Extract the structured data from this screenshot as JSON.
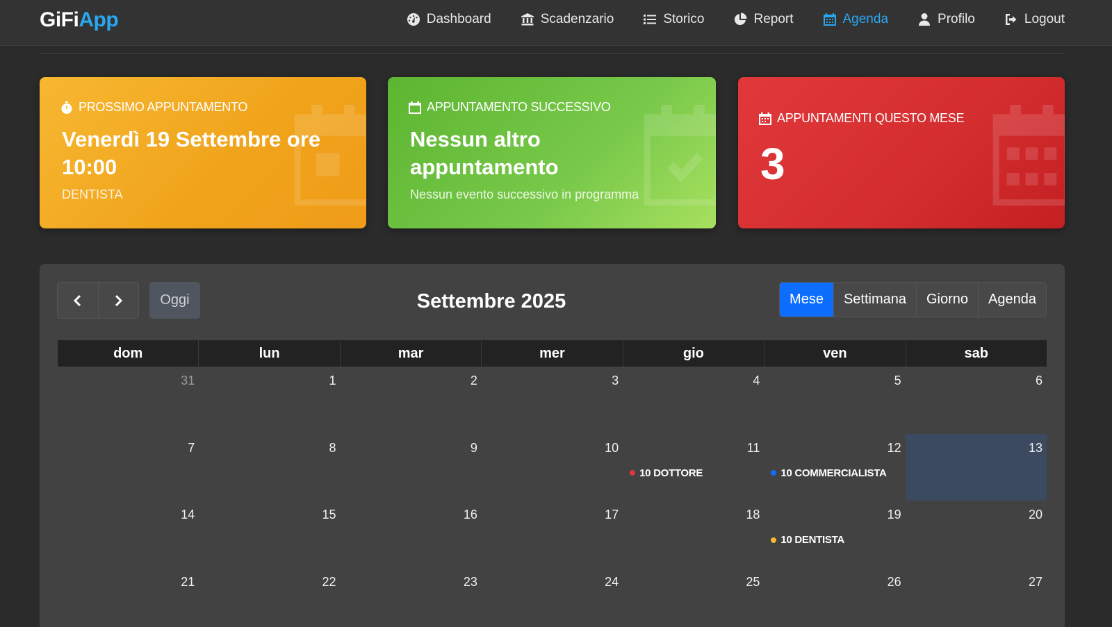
{
  "brand": {
    "part1": "GiFi",
    "part2": "App"
  },
  "nav": [
    {
      "label": "Dashboard",
      "icon": "dashboard-icon"
    },
    {
      "label": "Scadenzario",
      "icon": "bank-icon"
    },
    {
      "label": "Storico",
      "icon": "list-icon"
    },
    {
      "label": "Report",
      "icon": "pie-chart-icon"
    },
    {
      "label": "Agenda",
      "icon": "calendar-icon",
      "active": true
    },
    {
      "label": "Profilo",
      "icon": "user-icon"
    },
    {
      "label": "Logout",
      "icon": "logout-icon"
    }
  ],
  "cards": {
    "next": {
      "label": "PROSSIMO APPUNTAMENTO",
      "title": "Venerdì 19 Settembre ore 10:00",
      "sub": "DENTISTA",
      "color": "#f7b731"
    },
    "following": {
      "label": "APPUNTAMENTO SUCCESSIVO",
      "title": "Nessun altro appuntamento",
      "sub": "Nessun evento successivo in programma",
      "color": "#79c94a"
    },
    "month": {
      "label": "APPUNTAMENTI QUESTO MESE",
      "count": "3",
      "color": "#d42d2f"
    }
  },
  "calendar": {
    "prev_icon": "chevron-left-icon",
    "next_icon": "chevron-right-icon",
    "today_label": "Oggi",
    "title": "Settembre 2025",
    "views": [
      "Mese",
      "Settimana",
      "Giorno",
      "Agenda"
    ],
    "active_view": "Mese",
    "weekdays": [
      "dom",
      "lun",
      "mar",
      "mer",
      "gio",
      "ven",
      "sab"
    ],
    "weeks": [
      [
        {
          "n": "31",
          "other": true
        },
        {
          "n": "1"
        },
        {
          "n": "2"
        },
        {
          "n": "3"
        },
        {
          "n": "4"
        },
        {
          "n": "5"
        },
        {
          "n": "6"
        }
      ],
      [
        {
          "n": "7"
        },
        {
          "n": "8"
        },
        {
          "n": "9"
        },
        {
          "n": "10"
        },
        {
          "n": "11",
          "event": {
            "label": "10 DOTTORE",
            "color": "#e0383b"
          }
        },
        {
          "n": "12",
          "event": {
            "label": "10 COMMERCIALISTA",
            "color": "#0d6efd"
          }
        },
        {
          "n": "13",
          "today": true
        }
      ],
      [
        {
          "n": "14"
        },
        {
          "n": "15"
        },
        {
          "n": "16"
        },
        {
          "n": "17"
        },
        {
          "n": "18"
        },
        {
          "n": "19",
          "event": {
            "label": "10 DENTISTA",
            "color": "#f7b731"
          }
        },
        {
          "n": "20"
        }
      ],
      [
        {
          "n": "21"
        },
        {
          "n": "22"
        },
        {
          "n": "23"
        },
        {
          "n": "24"
        },
        {
          "n": "25"
        },
        {
          "n": "26"
        },
        {
          "n": "27"
        }
      ]
    ]
  }
}
